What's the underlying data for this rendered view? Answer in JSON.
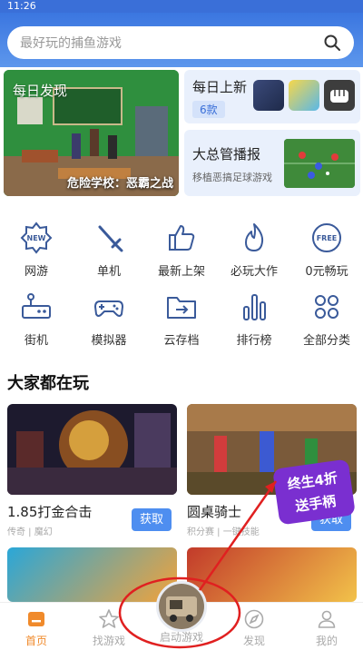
{
  "status_bar": {
    "time": "11:26"
  },
  "search": {
    "placeholder": "最好玩的捕鱼游戏"
  },
  "banner": {
    "tag": "每日发现",
    "caption": "危险学校：恶霸之战"
  },
  "daily": {
    "title": "每日上新",
    "count": "6款"
  },
  "report": {
    "title": "大总管播报",
    "subtitle": "移植恶搞足球游戏"
  },
  "categories": [
    {
      "label": "网游",
      "icon": "new-badge-icon"
    },
    {
      "label": "单机",
      "icon": "sword-icon"
    },
    {
      "label": "最新上架",
      "icon": "thumbs-up-icon"
    },
    {
      "label": "必玩大作",
      "icon": "flame-icon"
    },
    {
      "label": "0元畅玩",
      "icon": "free-badge-icon"
    },
    {
      "label": "街机",
      "icon": "arcade-icon"
    },
    {
      "label": "模拟器",
      "icon": "gamepad-icon"
    },
    {
      "label": "云存档",
      "icon": "folder-icon"
    },
    {
      "label": "排行榜",
      "icon": "bar-chart-icon"
    },
    {
      "label": "全部分类",
      "icon": "grid-dots-icon"
    }
  ],
  "section": {
    "title": "大家都在玩"
  },
  "games": [
    {
      "name": "1.85打金合击",
      "meta": "传奇 | 魔幻",
      "button": "获取"
    },
    {
      "name": "圆桌骑士",
      "meta": "积分赛 | 一键技能",
      "button": "获取"
    }
  ],
  "promo": {
    "line1": "终生4折",
    "line2": "送手柄"
  },
  "tabs": [
    {
      "label": "首页",
      "icon": "home-icon"
    },
    {
      "label": "找游戏",
      "icon": "star-icon"
    },
    {
      "label": "启动游戏",
      "icon": "launch-game-icon"
    },
    {
      "label": "发现",
      "icon": "compass-icon"
    },
    {
      "label": "我的",
      "icon": "profile-icon"
    }
  ],
  "colors": {
    "brand_blue": "#3a6fd8",
    "accent_orange": "#f08a2b",
    "button_blue": "#4e8ef0",
    "annotation_red": "#e02020"
  }
}
